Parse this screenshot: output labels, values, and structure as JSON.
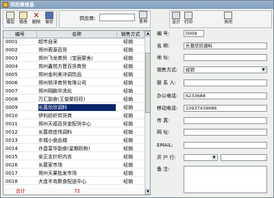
{
  "window": {
    "title": "供应商信息"
  },
  "toolbar": {
    "buttons": [
      "增加",
      "修改",
      "删除",
      "保存"
    ]
  },
  "search": {
    "label": "供应商:",
    "value": "",
    "button": "查询"
  },
  "actions": {
    "design": "设计",
    "print": "打印",
    "close": "关闭"
  },
  "table": {
    "headers": [
      "编号",
      "名称",
      "销售方式"
    ],
    "rows": [
      {
        "code": "0001",
        "name": "超市自采",
        "sale": "经销"
      },
      {
        "code": "0002",
        "name": "郑州蓉源百货",
        "sale": "经销"
      },
      {
        "code": "0003",
        "name": "郑州飞龙商贸（宝丽婴舍）",
        "sale": "经销"
      },
      {
        "code": "0004",
        "name": "郑州鑫悦方晋百货商贸",
        "sale": "经销"
      },
      {
        "code": "0005",
        "name": "郑州金利来冲调饮品",
        "sale": "经销"
      },
      {
        "code": "0006",
        "name": "郑州旭洋商贸有限公司",
        "sale": "经销"
      },
      {
        "code": "0007",
        "name": "郑州翔鹏华洗化",
        "sale": "经销"
      },
      {
        "code": "0008",
        "name": "万汇副食(王俊聚旺旺)",
        "sale": "经销"
      },
      {
        "code": "0009",
        "name": "长葛欣欣调料",
        "sale": "经销"
      },
      {
        "code": "0010",
        "name": "伊利纺织供货商",
        "sale": "经销"
      },
      {
        "code": "0011",
        "name": "郑州天福百货金配货中心",
        "sale": "经销"
      },
      {
        "code": "0012",
        "name": "长葛岗佳伟调料",
        "sale": "经销"
      },
      {
        "code": "0013",
        "name": "东城小食品城",
        "sale": "经销"
      },
      {
        "code": "0014",
        "name": "许昌富华副食(星期奶粉)",
        "sale": "经销"
      },
      {
        "code": "0015",
        "name": "安正志针织内衣",
        "sale": "经销"
      },
      {
        "code": "0016",
        "name": "长葛家市场",
        "sale": "经销"
      },
      {
        "code": "0017",
        "name": "郑州天果批发市场",
        "sale": "经销"
      },
      {
        "code": "0018",
        "name": "大连半岛数食配送中心",
        "sale": "经销"
      }
    ],
    "selected_index": 8,
    "footer": {
      "label": "合计",
      "count": "72"
    }
  },
  "form": {
    "code": {
      "label": "编  号:",
      "value": "0009"
    },
    "name": {
      "label": "名  称:",
      "value": "长葛欣欣调料"
    },
    "address": {
      "label": "地  址:",
      "value": ""
    },
    "sale_mode": {
      "label": "销售方式:",
      "value": "经销"
    },
    "contact": {
      "label": "联 系 人:",
      "value": ""
    },
    "office_phone": {
      "label": "办公电话:",
      "value": "6233688"
    },
    "mobile": {
      "label": "移动电话:",
      "value": "13937439686"
    },
    "fax": {
      "label": "传  真:",
      "value": ""
    },
    "website": {
      "label": "网  址:",
      "value": ""
    },
    "email": {
      "label": "EMAIL:",
      "value": ""
    },
    "bank": {
      "label": "开 户 行:",
      "value": ""
    },
    "remark": {
      "label": "备  注:",
      "value": ""
    }
  }
}
